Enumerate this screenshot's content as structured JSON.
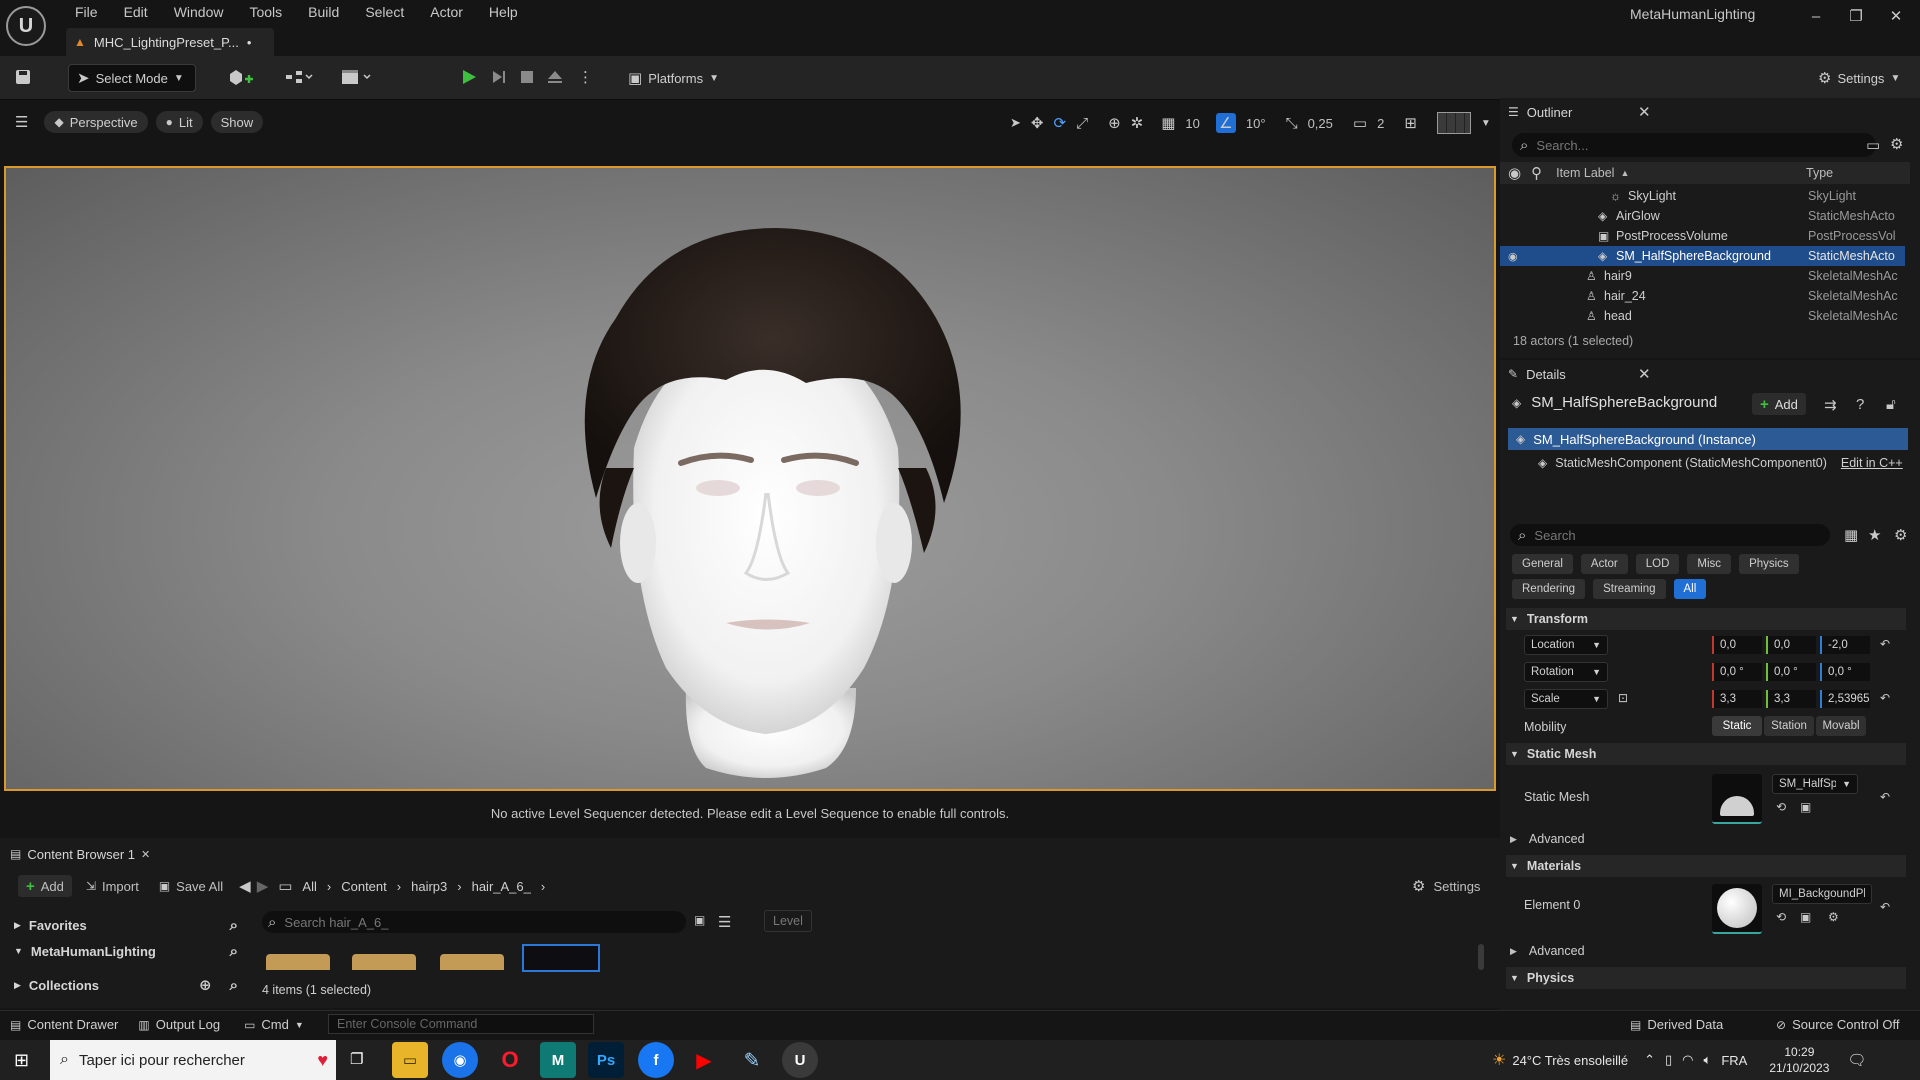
{
  "app": {
    "logo_glyph": "U",
    "project_title": "MetaHumanLighting",
    "menu": [
      "File",
      "Edit",
      "Window",
      "Tools",
      "Build",
      "Select",
      "Actor",
      "Help"
    ],
    "document_tab": "MHC_LightingPreset_P...",
    "document_tab_dirty": "•",
    "window_controls": {
      "minimize": "–",
      "restore": "❐",
      "close": "✕"
    }
  },
  "toolbar": {
    "select_mode": "Select Mode",
    "platforms": "Platforms",
    "settings": "Settings"
  },
  "viewport": {
    "perspective": "Perspective",
    "lit": "Lit",
    "show": "Show",
    "grid_snap": "10",
    "rotation_snap": "10°",
    "scale_snap": "0,25",
    "camera_speed": "2",
    "status_message": "No active Level Sequencer detected. Please edit a Level Sequence to enable full controls."
  },
  "outliner": {
    "tab": "Outliner",
    "search_placeholder": "Search...",
    "col_label": "Item Label",
    "col_type": "Type",
    "rows": [
      {
        "label": "SkyLight",
        "type": "SkyLight",
        "icon": "skylight-icon"
      },
      {
        "label": "AirGlow",
        "type": "StaticMeshActo",
        "icon": "mesh-icon"
      },
      {
        "label": "PostProcessVolume",
        "type": "PostProcessVol",
        "icon": "volume-icon"
      },
      {
        "label": "SM_HalfSphereBackground",
        "type": "StaticMeshActo",
        "icon": "mesh-icon"
      },
      {
        "label": "hair9",
        "type": "SkeletalMeshAc",
        "icon": "skeletal-icon"
      },
      {
        "label": "hair_24",
        "type": "SkeletalMeshAc",
        "icon": "skeletal-icon"
      },
      {
        "label": "head",
        "type": "SkeletalMeshAc",
        "icon": "skeletal-icon"
      }
    ],
    "selected_index": 3,
    "actor_count": "18 actors (1 selected)"
  },
  "details": {
    "tab": "Details",
    "object_name": "SM_HalfSphereBackground",
    "add_label": "Add",
    "instance_label": "SM_HalfSphereBackground (Instance)",
    "component_label": "StaticMeshComponent (StaticMeshComponent0)",
    "edit_cpp": "Edit in C++",
    "search_placeholder": "Search",
    "categories_row1": [
      "General",
      "Actor",
      "LOD",
      "Misc",
      "Physics"
    ],
    "categories_row2": [
      "Rendering",
      "Streaming",
      "All"
    ],
    "active_category": "All",
    "transform": {
      "title": "Transform",
      "location_label": "Location",
      "location": [
        "0,0",
        "0,0",
        "-2,0"
      ],
      "rotation_label": "Rotation",
      "rotation": [
        "0,0 °",
        "0,0 °",
        "0,0 °"
      ],
      "scale_label": "Scale",
      "scale": [
        "3,3",
        "3,3",
        "2,53965"
      ],
      "mobility_label": "Mobility",
      "mobility_options": [
        "Static",
        "Station",
        "Movabl"
      ],
      "mobility_selected": "Static"
    },
    "static_mesh": {
      "title": "Static Mesh",
      "label": "Static Mesh",
      "value": "SM_HalfSphe",
      "advanced": "Advanced"
    },
    "materials": {
      "title": "Materials",
      "element_label": "Element 0",
      "value": "MI_BackgoundPlane",
      "advanced": "Advanced"
    },
    "physics": {
      "title": "Physics"
    }
  },
  "content_browser": {
    "tab": "Content Browser 1",
    "add": "Add",
    "import": "Import",
    "save_all": "Save All",
    "breadcrumb": [
      "All",
      "Content",
      "hairp3",
      "hair_A_6_"
    ],
    "settings": "Settings",
    "favorites": "Favorites",
    "project": "MetaHumanLighting",
    "collections": "Collections",
    "search_placeholder": "Search hair_A_6_",
    "level_filter": "Level",
    "items_count": "4 items (1 selected)"
  },
  "statusbar": {
    "content_drawer": "Content Drawer",
    "output_log": "Output Log",
    "cmd": "Cmd",
    "console_placeholder": "Enter Console Command",
    "derived_data": "Derived Data",
    "source_control": "Source Control Off"
  },
  "taskbar": {
    "search_placeholder": "Taper ici pour rechercher",
    "weather": "24°C  Très ensoleillé",
    "language": "FRA",
    "time": "10:29",
    "date": "21/10/2023"
  },
  "colors": {
    "accent_blue": "#1f6fd6",
    "selection_blue": "#1f4c8a",
    "viewport_border": "#d99a2b",
    "play_green": "#3fbf3f",
    "axis_x": "#c0392b",
    "axis_y": "#6fbf3a",
    "axis_z": "#2f7fd6"
  }
}
